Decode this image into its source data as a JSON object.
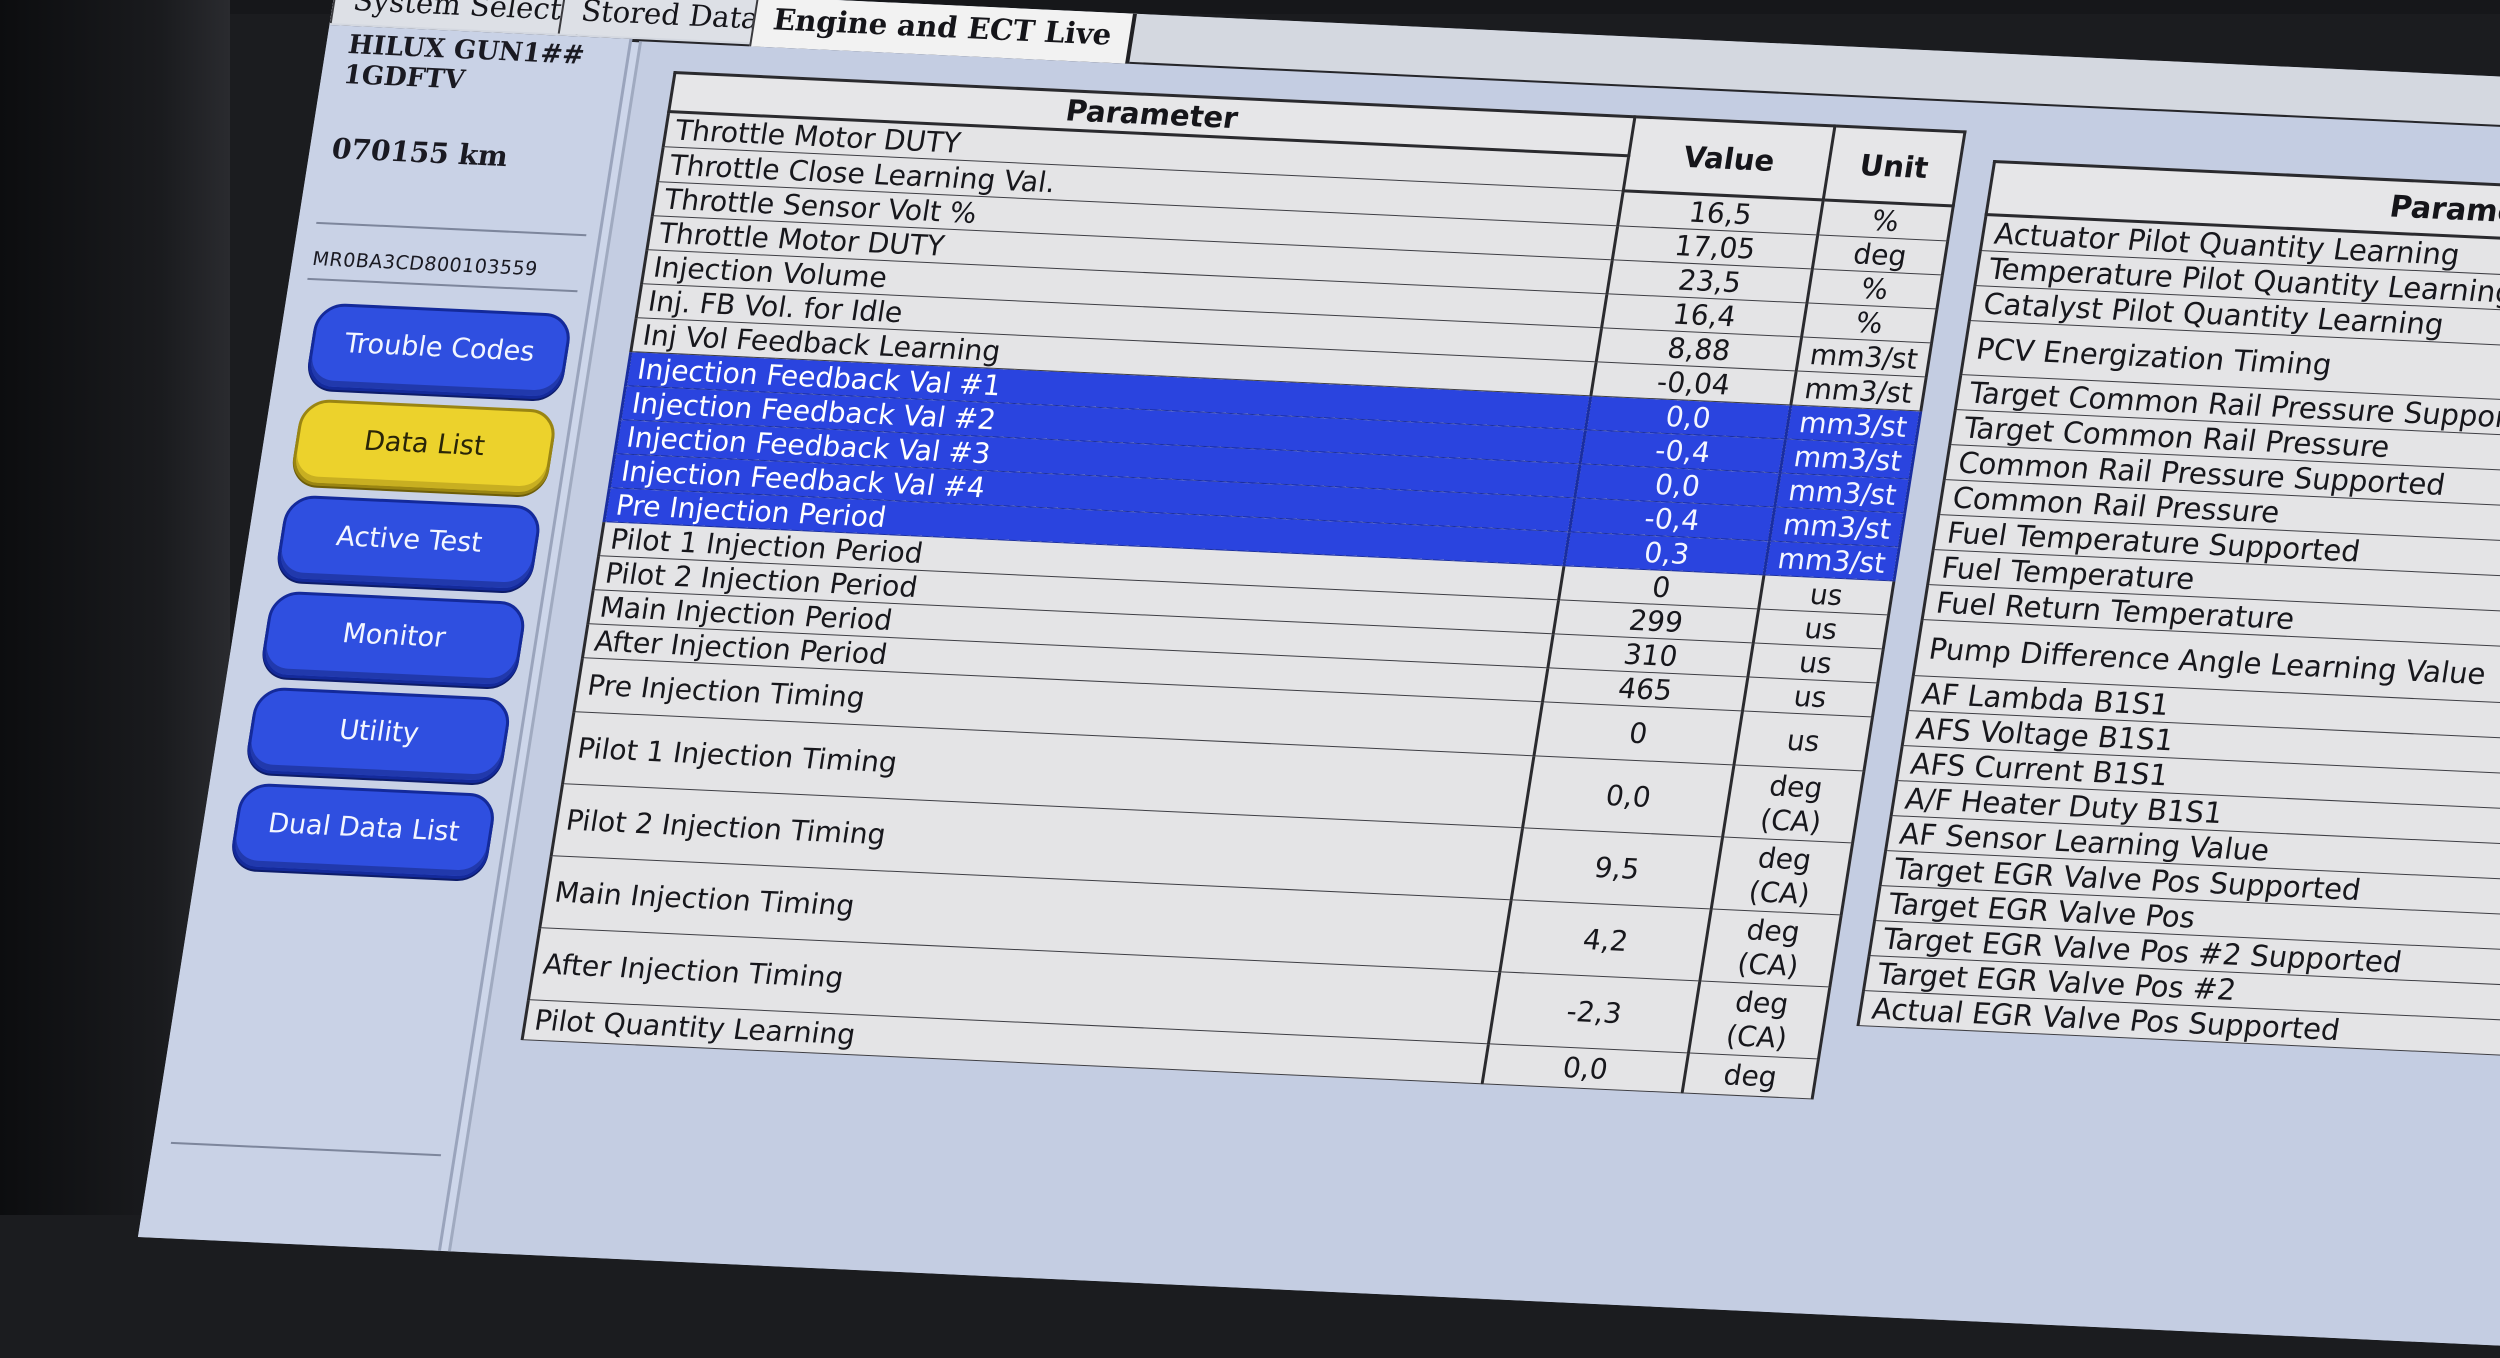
{
  "tabs": [
    {
      "label": "System Select",
      "active": false
    },
    {
      "label": "Stored Data",
      "active": false
    },
    {
      "label": "Engine and ECT Live",
      "active": true
    }
  ],
  "vehicle": {
    "model": "HILUX GUN1##",
    "engine": "1GDFTV",
    "odometer": "070155 km",
    "vin": "MR0BA3CD800103559"
  },
  "nav": [
    {
      "label": "Trouble Codes",
      "selected": false
    },
    {
      "label": "Data List",
      "selected": true
    },
    {
      "label": "Active Test",
      "selected": false
    },
    {
      "label": "Monitor",
      "selected": false
    },
    {
      "label": "Utility",
      "selected": false
    },
    {
      "label": "Dual Data List",
      "selected": false
    }
  ],
  "colors": {
    "nav_button": "#2f4fe0",
    "nav_selected": "#ecd22c",
    "row_highlight": "#2a44df"
  },
  "table1": {
    "headers": {
      "parameter": "Parameter",
      "value": "Value",
      "unit": "Unit"
    },
    "first_row": "Throttle Motor DUTY",
    "rows": [
      {
        "name": "Throttle Close Learning Val.",
        "value": "16,5",
        "unit": "%",
        "highlight": false
      },
      {
        "name": "Throttle Sensor Volt %",
        "value": "17,05",
        "unit": "deg",
        "highlight": false
      },
      {
        "name": "Throttle Motor DUTY",
        "value": "23,5",
        "unit": "%",
        "highlight": false
      },
      {
        "name": "Injection Volume",
        "value": "16,4",
        "unit": "%",
        "highlight": false
      },
      {
        "name": "Inj. FB Vol. for Idle",
        "value": "8,88",
        "unit": "mm3/st",
        "highlight": false
      },
      {
        "name": "Inj Vol Feedback Learning",
        "value": "-0,04",
        "unit": "mm3/st",
        "highlight": false
      },
      {
        "name": "Injection Feedback Val #1",
        "value": "0,0",
        "unit": "mm3/st",
        "highlight": true
      },
      {
        "name": "Injection Feedback Val #2",
        "value": "-0,4",
        "unit": "mm3/st",
        "highlight": true
      },
      {
        "name": "Injection Feedback Val #3",
        "value": "0,0",
        "unit": "mm3/st",
        "highlight": true
      },
      {
        "name": "Injection Feedback Val #4",
        "value": "-0,4",
        "unit": "mm3/st",
        "highlight": true
      },
      {
        "name": "Pre Injection Period",
        "value": "0,3",
        "unit": "mm3/st",
        "highlight": true
      },
      {
        "name": "Pilot 1 Injection Period",
        "value": "0",
        "unit": "us",
        "highlight": false
      },
      {
        "name": "Pilot 2 Injection Period",
        "value": "299",
        "unit": "us",
        "highlight": false
      },
      {
        "name": "Main Injection Period",
        "value": "310",
        "unit": "us",
        "highlight": false
      },
      {
        "name": "After Injection Period",
        "value": "465",
        "unit": "us",
        "highlight": false
      },
      {
        "name": "Pre Injection Timing",
        "value": "0",
        "unit": "us",
        "highlight": false
      },
      {
        "name": "Pilot 1 Injection Timing",
        "value": "0,0",
        "unit": "deg (CA)",
        "highlight": false
      },
      {
        "name": "Pilot 2 Injection Timing",
        "value": "9,5",
        "unit": "deg (CA)",
        "highlight": false
      },
      {
        "name": "Main Injection Timing",
        "value": "4,2",
        "unit": "deg (CA)",
        "highlight": false
      },
      {
        "name": "After Injection Timing",
        "value": "-2,3",
        "unit": "deg (CA)",
        "highlight": false
      },
      {
        "name": "Pilot Quantity Learning",
        "value": "0,0",
        "unit": "deg",
        "highlight": false
      }
    ]
  },
  "table2": {
    "header": "Parameter",
    "rows": [
      "Actuator Pilot Quantity Learning",
      "Temperature Pilot Quantity Learning",
      "Catalyst Pilot Quantity Learning",
      "PCV Energization Timing",
      "Target Common Rail Pressure Supported",
      "Target Common Rail Pressure",
      "Common Rail Pressure Supported",
      "Common Rail Pressure",
      "Fuel Temperature Supported",
      "Fuel Temperature",
      "Fuel Return Temperature",
      "Pump Difference Angle Learning Value",
      "AF Lambda B1S1",
      "AFS Voltage B1S1",
      "AFS Current B1S1",
      "A/F Heater Duty B1S1",
      "AF Sensor Learning Value",
      "Target EGR Valve Pos Supported",
      "Target EGR Valve Pos",
      "Target EGR Valve Pos #2 Supported",
      "Target EGR Valve Pos #2",
      "Actual EGR Valve Pos Supported"
    ]
  }
}
